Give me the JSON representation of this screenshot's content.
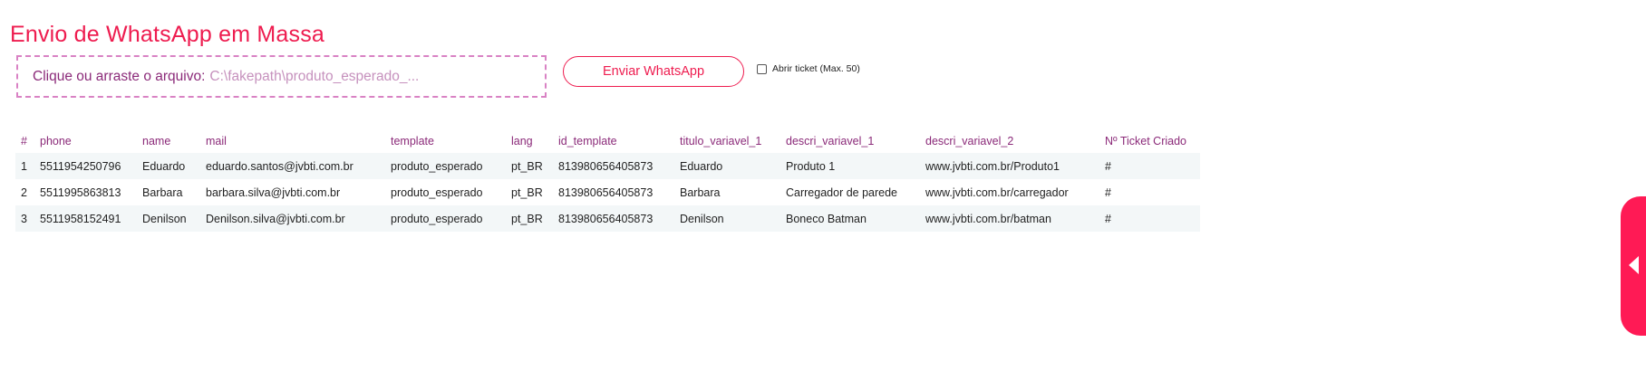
{
  "page": {
    "title": "Envio de WhatsApp em Massa"
  },
  "upload": {
    "label": "Clique ou arraste o arquivo:",
    "filename": "C:\\fakepath\\produto_esperado_..."
  },
  "actions": {
    "send_label": "Enviar WhatsApp",
    "ticket_checkbox_label": "Abrir ticket (Max. 50)",
    "ticket_checked": false
  },
  "table": {
    "headers": [
      "#",
      "phone",
      "name",
      "mail",
      "template",
      "lang",
      "id_template",
      "titulo_variavel_1",
      "descri_variavel_1",
      "descri_variavel_2",
      "Nº Ticket Criado"
    ],
    "rows": [
      [
        "1",
        "5511954250796",
        "Eduardo",
        "eduardo.santos@jvbti.com.br",
        "produto_esperado",
        "pt_BR",
        "813980656405873",
        "Eduardo",
        "Produto 1",
        "www.jvbti.com.br/Produto1",
        "#"
      ],
      [
        "2",
        "5511995863813",
        "Barbara",
        "barbara.silva@jvbti.com.br",
        "produto_esperado",
        "pt_BR",
        "813980656405873",
        "Barbara",
        "Carregador de parede",
        "www.jvbti.com.br/carregador",
        "#"
      ],
      [
        "3",
        "5511958152491",
        "Denilson",
        "Denilson.silva@jvbti.com.br",
        "produto_esperado",
        "pt_BR",
        "813980656405873",
        "Denilson",
        "Boneco Batman",
        "www.jvbti.com.br/batman",
        "#"
      ]
    ]
  },
  "side_panel": {
    "icon": "caret-left-icon"
  },
  "colors": {
    "accent": "#ee1c4f",
    "header_text": "#8b2a79",
    "dashed_border": "#d982c4",
    "row_stripe": "#f3f7f8",
    "side_tab": "#ff1a55"
  }
}
